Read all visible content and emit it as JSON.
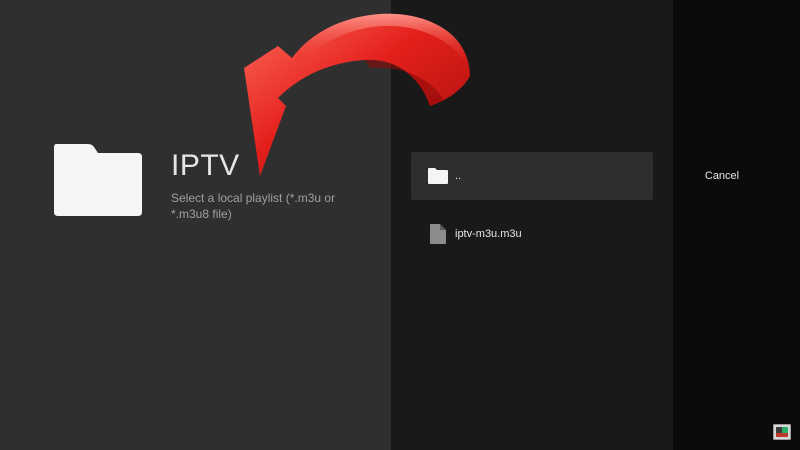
{
  "header": {
    "title": "IPTV",
    "subtitle": "Select a local playlist (*.m3u or *.m3u8 file)"
  },
  "icons": {
    "header_icon": "folder-icon",
    "parent_icon": "folder-icon",
    "file_icon": "file-icon",
    "annotation": "red-arrow-icon",
    "corner": "app-badge-icon"
  },
  "files": {
    "parent_label": "..",
    "playlist_label": "iptv-m3u.m3u"
  },
  "actions": {
    "cancel_label": "Cancel"
  },
  "colors": {
    "arrow_red": "#e3201b",
    "left_panel": "#2f2f2f",
    "middle_panel": "#191919",
    "right_panel": "#0b0b0b",
    "selected_row": "#2e2e2e"
  }
}
